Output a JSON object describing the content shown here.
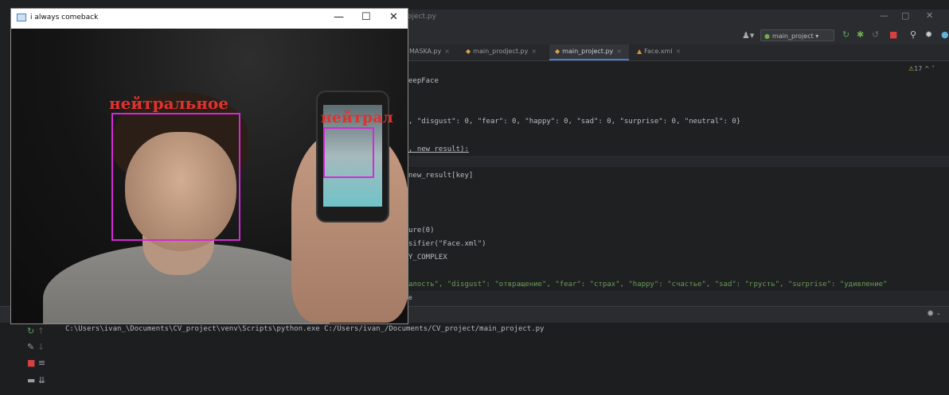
{
  "ide": {
    "title": "oject.py",
    "window_controls": {
      "minimize": "—",
      "maximize": "▢",
      "close": "✕"
    },
    "run_config": "main_project",
    "tabs": [
      {
        "label": "MASKA.py",
        "active": false
      },
      {
        "label": "main_prodject.py",
        "active": false
      },
      {
        "label": "main_project.py",
        "active": true
      },
      {
        "label": "Face.xml",
        "active": false
      }
    ],
    "warnings": "17",
    "code_lines": [
      "eepFace",
      ", \"disgust\": 0, \"fear\": 0, \"happy\": 0, \"sad\": 0, \"surprise\": 0, \"neutral\": 0}",
      ", new_result):",
      "new_result[key]",
      "ure(0)",
      "sifier(\"Face.xml\")",
      "Y_COMPLEX",
      "алость\", \"disgust\": \"отвращение\", \"fear\": \"страх\", \"happy\": \"счастье\", \"sad\": \"грусть\", \"surprise\": \"удивление\"",
      "e"
    ],
    "run_command": "C:\\Users\\ivan_\\Documents\\CV_project\\venv\\Scripts\\python.exe C:/Users/ivan_/Documents/CV_project/main_project.py"
  },
  "cv_window": {
    "title": "i always comeback",
    "window_controls": {
      "minimize": "—",
      "maximize": "☐",
      "close": "✕"
    },
    "detections": [
      {
        "label": "нейтральное"
      },
      {
        "label": "нейтрал"
      }
    ],
    "colors": {
      "box": "#d42ad4",
      "label": "#e0322f"
    }
  }
}
